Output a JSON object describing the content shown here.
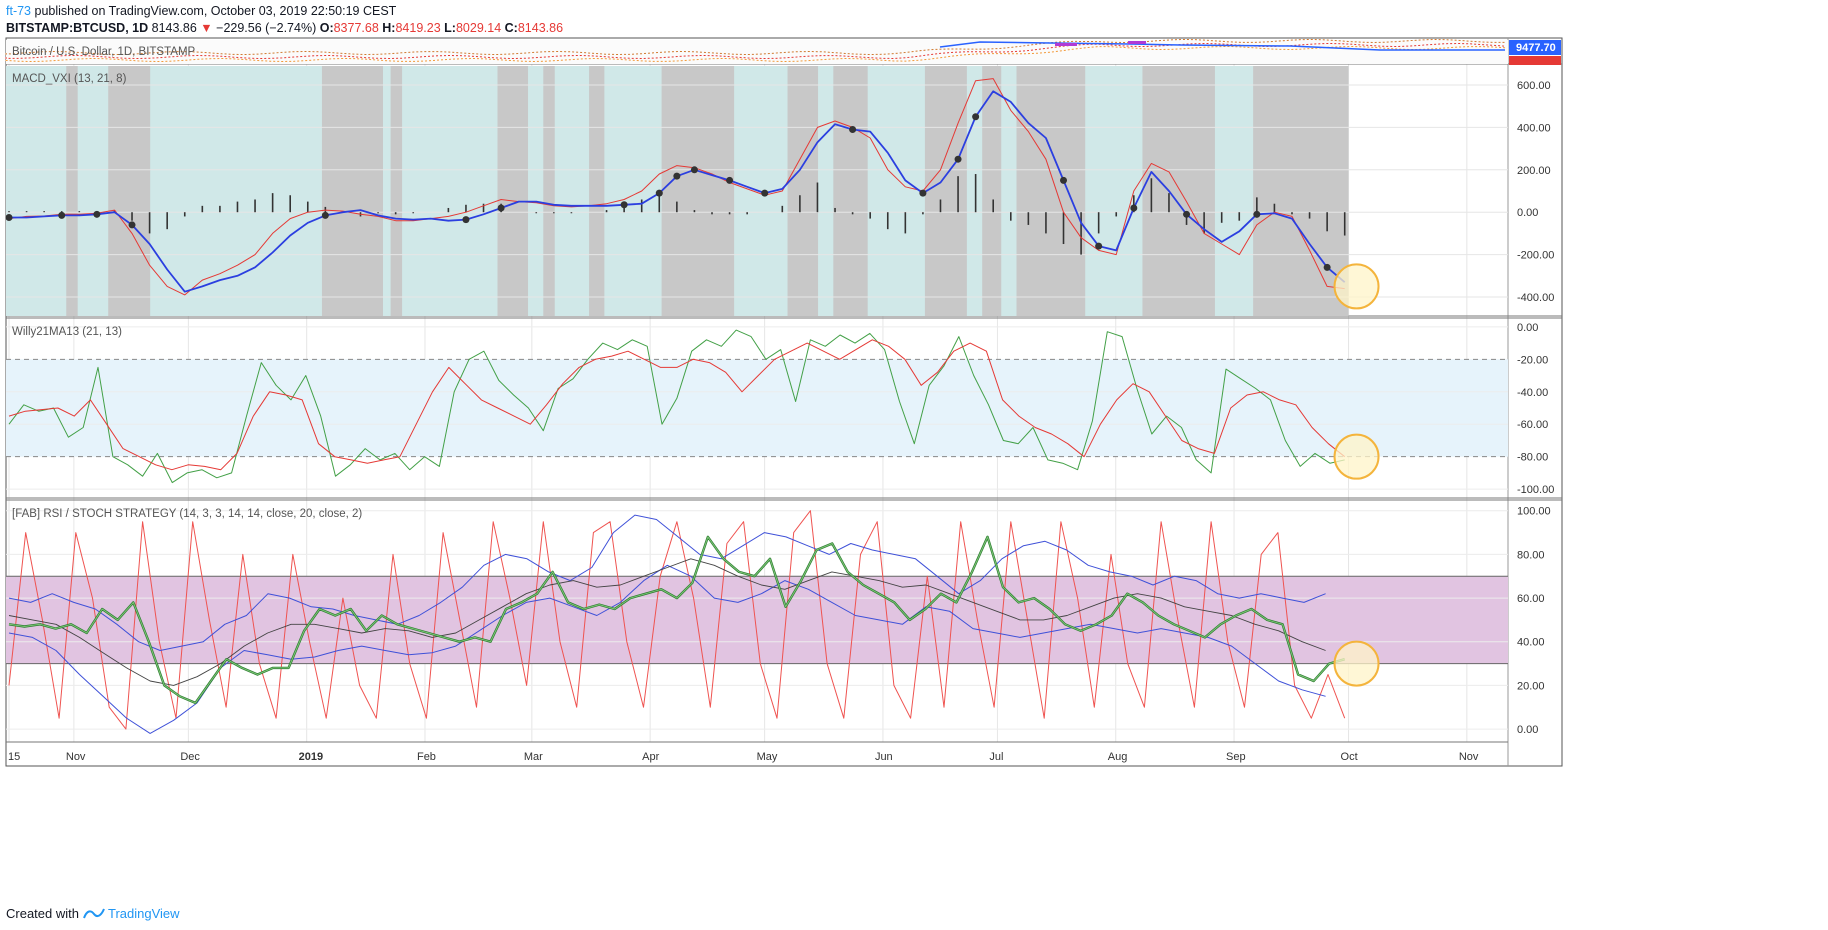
{
  "header": {
    "author": "ft-73",
    "published": "published on TradingView.com, October 03, 2019 22:50:19 CEST",
    "symbol": "BITSTAMP:BTCUSD, 1D",
    "last": "8143.86",
    "change_arrow": "▼",
    "change": "−229.56 (−2.74%)",
    "o_label": "O:",
    "o_value": "8377.68",
    "h_label": "H:",
    "h_value": "8419.23",
    "l_label": "L:",
    "l_value": "8029.14",
    "c_label": "C:",
    "c_value": "8143.86"
  },
  "footer": {
    "created_with": "Created with",
    "brand": "TradingView"
  },
  "colors": {
    "accent": "#2196f3",
    "down": "#e53935",
    "macd_teal_bg": "#d0e8e8",
    "macd_gray_bg": "#c8c8c8",
    "willy_band": "#e6f3fb",
    "rsi_band": "#e1c4e1",
    "highlight_fill": "#fff4c8",
    "highlight_stroke": "#f4b43c"
  },
  "chart_data": [
    {
      "type": "line",
      "title": "Bitcoin / U.S. Dollar, 1D, BITSTAMP",
      "price_labels": [
        "9477.70",
        "8143.86"
      ],
      "series": [
        {
          "name": "price",
          "values": [
            8143.86
          ]
        }
      ]
    },
    {
      "type": "line",
      "title": "MACD_VXI (13, 21, 8)",
      "ylim": [
        -480,
        680
      ],
      "yticks": [
        "600.00",
        "400.00",
        "200.00",
        "0.00",
        "-200.00",
        "-400.00"
      ],
      "ytick_values": [
        600,
        400,
        200,
        0,
        -200,
        -400
      ],
      "x_days": [
        0,
        5,
        10,
        15,
        20,
        25,
        30,
        35,
        40,
        45,
        50,
        55,
        60,
        65,
        70,
        75,
        80,
        85,
        90,
        95,
        100,
        105,
        110,
        115,
        120,
        125,
        130,
        135,
        140,
        145,
        150,
        155,
        160,
        165,
        170,
        175,
        180,
        185,
        190,
        195,
        200,
        205,
        210,
        215,
        220,
        225,
        230,
        235,
        240,
        245,
        250,
        255,
        260,
        265,
        270,
        275,
        280,
        285,
        290,
        295,
        300,
        305,
        310,
        315,
        320,
        325,
        330,
        335,
        340,
        345,
        350
      ],
      "series": [
        {
          "name": "signal",
          "values": [
            -25,
            -25,
            -20,
            -15,
            -15,
            -10,
            0,
            -60,
            -150,
            -270,
            -375,
            -350,
            -320,
            -300,
            -260,
            -190,
            -110,
            -50,
            -15,
            0,
            10,
            -15,
            -30,
            -35,
            -30,
            -40,
            -35,
            -10,
            20,
            50,
            50,
            35,
            30,
            30,
            30,
            35,
            40,
            90,
            170,
            200,
            175,
            150,
            120,
            90,
            110,
            200,
            330,
            415,
            390,
            380,
            280,
            150,
            90,
            140,
            250,
            450,
            570,
            520,
            420,
            350,
            150,
            -50,
            -160,
            -180,
            20,
            190,
            100,
            -10,
            -80,
            -140,
            -90,
            -10,
            -5,
            -30,
            -150,
            -260,
            -330
          ]
        },
        {
          "name": "fast",
          "values": [
            -30,
            -20,
            -18,
            -10,
            -10,
            -5,
            10,
            -100,
            -250,
            -350,
            -390,
            -320,
            -290,
            -250,
            -200,
            -100,
            -30,
            0,
            10,
            5,
            -10,
            -20,
            -40,
            -40,
            -30,
            -20,
            0,
            30,
            60,
            50,
            45,
            30,
            25,
            30,
            40,
            60,
            100,
            180,
            220,
            210,
            180,
            140,
            110,
            80,
            100,
            250,
            400,
            430,
            400,
            350,
            200,
            120,
            100,
            200,
            420,
            620,
            630,
            480,
            380,
            250,
            0,
            -120,
            -180,
            -200,
            100,
            230,
            190,
            50,
            -100,
            -150,
            -200,
            -60,
            0,
            -20,
            -180,
            -350,
            -360
          ]
        },
        {
          "name": "histogram",
          "values": [
            5,
            5,
            5,
            5,
            5,
            5,
            10,
            -40,
            -100,
            -80,
            -20,
            30,
            30,
            50,
            60,
            90,
            80,
            50,
            25,
            5,
            -20,
            -5,
            -10,
            -5,
            0,
            20,
            35,
            40,
            40,
            0,
            -5,
            -5,
            -5,
            0,
            10,
            25,
            60,
            90,
            50,
            10,
            -10,
            -10,
            -10,
            0,
            30,
            80,
            140,
            20,
            -10,
            -30,
            -80,
            -100,
            -10,
            60,
            170,
            180,
            60,
            -40,
            -60,
            -100,
            -150,
            -200,
            -100,
            -20,
            80,
            160,
            90,
            -60,
            -100,
            -50,
            -40,
            70,
            40,
            -10,
            -30,
            -90,
            -110
          ]
        }
      ]
    },
    {
      "type": "line",
      "title": "Willy21MA13 (21, 13)",
      "ylim": [
        -103,
        3
      ],
      "yticks": [
        "0.00",
        "-20.00",
        "-40.00",
        "-60.00",
        "-80.00",
        "-100.00"
      ],
      "ytick_values": [
        0,
        -20,
        -40,
        -60,
        -80,
        -100
      ],
      "band": [
        -80,
        -20
      ],
      "series": [
        {
          "name": "willy",
          "values": [
            -60,
            -48,
            -52,
            -50,
            -68,
            -62,
            -25,
            -80,
            -85,
            -92,
            -78,
            -96,
            -90,
            -88,
            -93,
            -90,
            -55,
            -22,
            -36,
            -45,
            -30,
            -55,
            -92,
            -85,
            -75,
            -82,
            -78,
            -88,
            -80,
            -86,
            -40,
            -20,
            -15,
            -33,
            -42,
            -50,
            -64,
            -38,
            -32,
            -20,
            -10,
            -14,
            -8,
            -12,
            -60,
            -44,
            -15,
            -8,
            -12,
            -2,
            -6,
            -20,
            -14,
            -46,
            -8,
            -12,
            -5,
            -10,
            -4,
            -14,
            -46,
            -72,
            -36,
            -24,
            -6,
            -30,
            -48,
            -70,
            -72,
            -62,
            -82,
            -84,
            -88,
            -58,
            -3,
            -6,
            -38,
            -66,
            -55,
            -62,
            -82,
            -90,
            -26,
            -32,
            -38,
            -45,
            -70,
            -86,
            -78,
            -84,
            -82
          ]
        },
        {
          "name": "ma",
          "values": [
            -55,
            -52,
            -51,
            -50,
            -55,
            -45,
            -60,
            -75,
            -80,
            -85,
            -88,
            -85,
            -86,
            -88,
            -78,
            -55,
            -40,
            -42,
            -45,
            -72,
            -80,
            -82,
            -84,
            -82,
            -80,
            -60,
            -40,
            -25,
            -35,
            -45,
            -50,
            -55,
            -60,
            -48,
            -35,
            -25,
            -20,
            -18,
            -15,
            -20,
            -25,
            -25,
            -20,
            -22,
            -28,
            -40,
            -30,
            -20,
            -15,
            -10,
            -15,
            -20,
            -14,
            -8,
            -12,
            -20,
            -36,
            -28,
            -15,
            -10,
            -15,
            -45,
            -55,
            -62,
            -66,
            -72,
            -80,
            -60,
            -45,
            -35,
            -40,
            -55,
            -70,
            -75,
            -78,
            -50,
            -42,
            -40,
            -45,
            -48,
            -62,
            -72,
            -80
          ]
        }
      ]
    },
    {
      "type": "line",
      "title": "[FAB] RSI / STOCH STRATEGY (14, 3, 3, 14, 14, close, 20, close, 2)",
      "ylim": [
        -5,
        104
      ],
      "yticks": [
        "100.00",
        "80.00",
        "60.00",
        "40.00",
        "20.00",
        "0.00"
      ],
      "ytick_values": [
        100,
        80,
        60,
        40,
        20,
        0
      ],
      "band": [
        30,
        70
      ],
      "series": [
        {
          "name": "rsi",
          "values": [
            48,
            47,
            48,
            46,
            48,
            44,
            55,
            50,
            58,
            40,
            20,
            15,
            12,
            22,
            32,
            28,
            25,
            28,
            28,
            45,
            55,
            52,
            55,
            45,
            52,
            48,
            46,
            44,
            42,
            40,
            42,
            40,
            55,
            58,
            62,
            72,
            58,
            55,
            57,
            55,
            60,
            62,
            64,
            60,
            67,
            88,
            78,
            72,
            70,
            78,
            56,
            68,
            82,
            85,
            72,
            66,
            62,
            58,
            50,
            55,
            62,
            58,
            72,
            88,
            65,
            58,
            60,
            55,
            48,
            45,
            48,
            52,
            62,
            58,
            52,
            48,
            45,
            42,
            48,
            52,
            55,
            50,
            48,
            25,
            22,
            30,
            32
          ]
        },
        {
          "name": "stoch",
          "values": [
            20,
            90,
            50,
            5,
            90,
            60,
            10,
            0,
            95,
            40,
            5,
            95,
            50,
            10,
            80,
            30,
            5,
            80,
            40,
            5,
            60,
            20,
            5,
            80,
            30,
            5,
            90,
            50,
            10,
            95,
            60,
            20,
            95,
            40,
            10,
            90,
            95,
            40,
            10,
            70,
            95,
            60,
            10,
            85,
            95,
            30,
            5,
            90,
            100,
            30,
            5,
            80,
            95,
            20,
            5,
            70,
            10,
            95,
            50,
            10,
            95,
            50,
            5,
            95,
            60,
            10,
            80,
            30,
            10,
            95,
            50,
            10,
            95,
            40,
            10,
            80,
            90,
            20,
            5,
            25,
            5
          ]
        },
        {
          "name": "bb_upper",
          "values": [
            60,
            58,
            62,
            58,
            55,
            48,
            40,
            36,
            38,
            40,
            48,
            52,
            62,
            60,
            56,
            55,
            52,
            50,
            48,
            52,
            58,
            65,
            75,
            80,
            78,
            72,
            68,
            74,
            90,
            98,
            96,
            88,
            80,
            78,
            84,
            90,
            88,
            84,
            80,
            85,
            82,
            80,
            78,
            70,
            62,
            68,
            78,
            84,
            86,
            82,
            75,
            72,
            70,
            66,
            70,
            68,
            62,
            60,
            62,
            60,
            58,
            62
          ]
        },
        {
          "name": "bb_lower",
          "values": [
            44,
            42,
            36,
            25,
            15,
            5,
            -2,
            4,
            12,
            28,
            36,
            34,
            32,
            33,
            36,
            38,
            36,
            34,
            35,
            38,
            45,
            52,
            58,
            60,
            56,
            52,
            58,
            68,
            75,
            70,
            60,
            58,
            62,
            68,
            64,
            58,
            52,
            50,
            48,
            56,
            54,
            46,
            44,
            42,
            44,
            46,
            48,
            46,
            44,
            46,
            44,
            42,
            38,
            30,
            22,
            18,
            15
          ]
        },
        {
          "name": "bb_mid",
          "values": [
            52,
            50,
            48,
            42,
            35,
            28,
            22,
            20,
            24,
            30,
            38,
            44,
            48,
            48,
            46,
            44,
            46,
            45,
            42,
            44,
            50,
            56,
            62,
            66,
            68,
            65,
            66,
            70,
            74,
            78,
            75,
            70,
            66,
            64,
            68,
            72,
            70,
            68,
            65,
            66,
            62,
            58,
            54,
            50,
            50,
            52,
            56,
            60,
            62,
            60,
            56,
            54,
            52,
            48,
            45,
            40,
            36
          ]
        }
      ]
    }
  ],
  "x_axis": {
    "labels": [
      "15",
      "Nov",
      "Dec",
      "2019",
      "Feb",
      "Mar",
      "Apr",
      "May",
      "Jun",
      "Jul",
      "Aug",
      "Sep",
      "Oct",
      "Nov"
    ],
    "label_days": [
      0,
      17,
      47,
      78,
      109,
      137,
      168,
      198,
      229,
      259,
      290,
      321,
      351,
      382
    ]
  }
}
